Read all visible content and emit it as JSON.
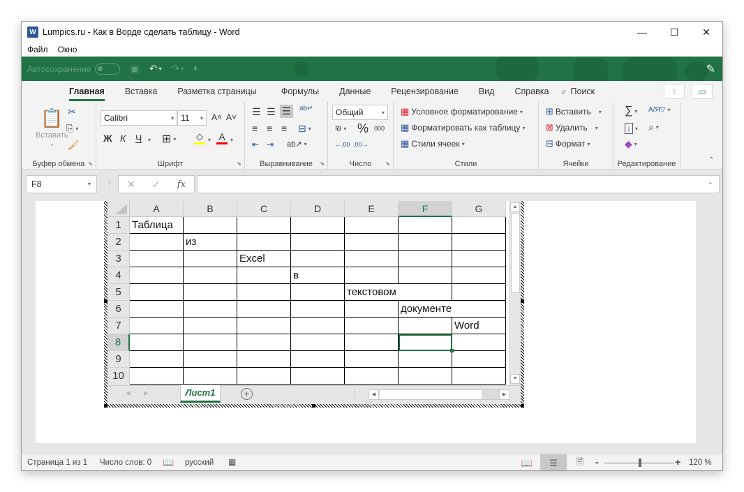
{
  "window": {
    "title": "Lumpics.ru - Как в Ворде сделать таблицу - Word",
    "app_icon": "W",
    "controls": {
      "minimize": "—",
      "maximize": "☐",
      "close": "✕"
    }
  },
  "menubar": {
    "items": [
      "Файл",
      "Окно"
    ]
  },
  "qat": {
    "autosave_label": "Автосохранение",
    "save_icon": "💾",
    "undo_icon": "↶",
    "redo_icon": "↷",
    "customize_icon": "⩡",
    "pen_icon": "✎"
  },
  "ribbon": {
    "tabs": [
      "Главная",
      "Вставка",
      "Разметка страницы",
      "Формулы",
      "Данные",
      "Рецензирование",
      "Вид",
      "Справка"
    ],
    "active_tab": "Главная",
    "search_label": "Поиск",
    "groups": {
      "clipboard": {
        "label": "Буфер обмена",
        "paste": "Вставить"
      },
      "font": {
        "label": "Шрифт",
        "font_name": "Calibri",
        "font_size": "11",
        "grow": "A˄",
        "shrink": "A˅",
        "bold": "Ж",
        "italic": "К",
        "underline": "Ч",
        "fill_color": "#ffff00",
        "font_color": "#ff0000"
      },
      "alignment": {
        "label": "Выравнивание"
      },
      "number": {
        "label": "Число",
        "format": "Общий",
        "percent": "%",
        "thousands": "000",
        "inc_decimal": "←0\n,00",
        "dec_decimal": ",00\n→0"
      },
      "styles": {
        "label": "Стили",
        "conditional": "Условное форматирование",
        "format_as_table": "Форматировать как таблицу",
        "cell_styles": "Стили ячеек"
      },
      "cells": {
        "label": "Ячейки",
        "insert": "Вставить",
        "delete": "Удалить",
        "format": "Формат"
      },
      "editing": {
        "label": "Редактирование",
        "sum": "∑",
        "sort": "АЯ▽",
        "fill": "↓",
        "find": "⌕",
        "clear": "◇"
      }
    }
  },
  "formula_bar": {
    "name_box": "F8",
    "cancel": "✕",
    "enter": "✓",
    "fx": "fx",
    "value": ""
  },
  "spreadsheet": {
    "columns": [
      "A",
      "B",
      "C",
      "D",
      "E",
      "F",
      "G"
    ],
    "selected_column": "F",
    "rows": [
      {
        "num": "1",
        "cells": [
          "Таблица",
          "",
          "",
          "",
          "",
          "",
          ""
        ]
      },
      {
        "num": "2",
        "cells": [
          "",
          "из",
          "",
          "",
          "",
          "",
          ""
        ]
      },
      {
        "num": "3",
        "cells": [
          "",
          "",
          "Excel",
          "",
          "",
          "",
          ""
        ]
      },
      {
        "num": "4",
        "cells": [
          "",
          "",
          "",
          "в",
          "",
          "",
          ""
        ]
      },
      {
        "num": "5",
        "cells": [
          "",
          "",
          "",
          "",
          "текстовом",
          "",
          ""
        ]
      },
      {
        "num": "6",
        "cells": [
          "",
          "",
          "",
          "",
          "",
          "документе",
          ""
        ]
      },
      {
        "num": "7",
        "cells": [
          "",
          "",
          "",
          "",
          "",
          "",
          "Word"
        ]
      },
      {
        "num": "8",
        "cells": [
          "",
          "",
          "",
          "",
          "",
          "",
          ""
        ]
      },
      {
        "num": "9",
        "cells": [
          "",
          "",
          "",
          "",
          "",
          "",
          ""
        ]
      },
      {
        "num": "10",
        "cells": [
          "",
          "",
          "",
          "",
          "",
          "",
          ""
        ]
      }
    ],
    "selected_row": "8",
    "active_cell": "F8",
    "sheet_tab": "Лист1",
    "add_sheet": "+"
  },
  "statusbar": {
    "page": "Страница 1 из 1",
    "words": "Число слов: 0",
    "language": "русский",
    "zoom_minus": "-",
    "zoom_plus": "+",
    "zoom": "120 %"
  }
}
